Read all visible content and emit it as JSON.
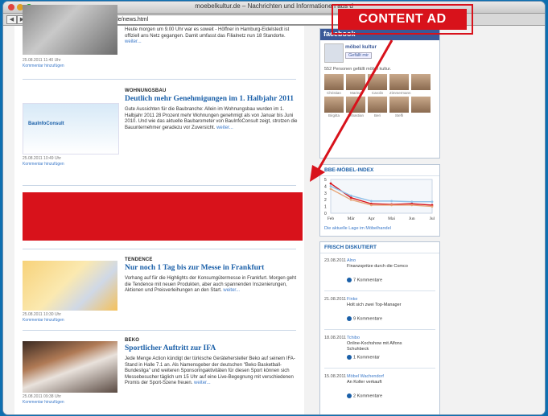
{
  "window": {
    "title": "moebelkultur.de – Nachrichten und Informationen aus d",
    "url": "http://www.moebelkultur.de/news.html"
  },
  "annotation": {
    "label": "CONTENT AD"
  },
  "articles": [
    {
      "category": "",
      "headline": "",
      "text": "Heute morgen um 9.00 Uhr war es soweit - Höffner in Hamburg-Eidelstedt ist offiziell ans Netz gegangen. Damit umfasst das Filialnetz nun 18 Standorte.",
      "more": "weiter...",
      "date": "25.08.2011 11:40 Uhr",
      "comment": "Kommentar hinzufügen"
    },
    {
      "category": "WOHNUNGSBAU",
      "headline": "Deutlich mehr Genehmigungen im 1. Halbjahr 2011",
      "thumb_label": "BauInfoConsult",
      "text": "Gute Aussichten für die Baubranche: Allein im Wohnungsbau wurden im 1. Halbjahr 2011 28 Prozent mehr Wohnungen genehmigt als von Januar bis Juni 2010. Und wie das aktuelle Baubarometer von BauInfoConsult zeigt, strotzen die Bauunternehmer geradezu vor Zuversicht.",
      "more": "weiter...",
      "date": "25.08.2011 10:49 Uhr",
      "comment": "Kommentar hinzufügen"
    },
    {
      "category": "TENDENCE",
      "headline": "Nur noch 1 Tag bis zur Messe in Frankfurt",
      "text": "Vorhang auf für die Highlights der Konsumgütermesse in Frankfurt. Morgen geht die Tendence mit neuen Produkten, aber auch spannenden Inszenierungen, Aktionen und Preisverleihungen an den Start.",
      "more": "weiter...",
      "date": "25.08.2011 10:30 Uhr",
      "comment": "Kommentar hinzufügen"
    },
    {
      "category": "BEKO",
      "headline": "Sportlicher Auftritt zur IFA",
      "text": "Jede Menge Action kündigt der türkische Gerätehersteller Beko auf seinem IFA-Stand in Halle 7.1 an. Als Namensgeber der deutschen \"Beko Basketball-Bundesliga\" und weiteren Sponsoringaktivitäten für diesen Sport können sich Messebesucher täglich um 15 Uhr auf eine Live-Begegnung mit verschiedenen Promis der Sport-Szene freuen.",
      "more": "weiter...",
      "date": "25.08.2011 09:38 Uhr",
      "comment": "Kommentar hinzufügen"
    }
  ],
  "facebook": {
    "header": "facebook",
    "page_name": "möbel kultur",
    "like": "Gefällt mir",
    "fans_line": "552 Personen gefällt möbel kultur.",
    "fans_row1": [
      "Christian",
      "Marina",
      "Carolin",
      "Zimmermann",
      ""
    ],
    "fans_row2": [
      "Birgitta",
      "Sebastian",
      "Beri",
      "Steffi",
      ""
    ]
  },
  "index": {
    "title": "BBE-MÖBEL-INDEX",
    "link": "Die aktuelle Lage im Möbelhandel",
    "chart_data": {
      "type": "line",
      "categories": [
        "Feb",
        "Mär",
        "Apr",
        "Mai",
        "Jun",
        "Jul"
      ],
      "ylim": [
        0,
        5
      ],
      "yticks": [
        "5",
        "4",
        "3",
        "2",
        "1",
        "0"
      ],
      "series": [
        {
          "color": "#d8121b",
          "values": [
            4.4,
            2.3,
            1.4,
            1.3,
            1.4,
            1.2
          ]
        },
        {
          "color": "#8fc0e8",
          "values": [
            4.0,
            2.6,
            1.8,
            1.8,
            1.7,
            1.7
          ]
        },
        {
          "color": "#e7a77a",
          "values": [
            3.6,
            2.0,
            1.2,
            1.2,
            1.2,
            1.0
          ]
        }
      ]
    }
  },
  "discussed": {
    "title": "FRISCH DISKUTIERT",
    "items": [
      {
        "date": "23.08.2011",
        "title": "Alno",
        "subtitle": "Finanzspritze durch die Comco",
        "comments": "7 Kommentare"
      },
      {
        "date": "21.08.2011",
        "title": "Finke",
        "subtitle": "Holt sich zwei Top-Manager",
        "comments": "9 Kommentare"
      },
      {
        "date": "18.08.2011",
        "title": "Tchibo",
        "subtitle": "Online-Kochshow mit Alfons Schuhbeck",
        "comments": "1 Kommentar"
      },
      {
        "date": "15.08.2011",
        "title": "Möbel Wachendorf",
        "subtitle": "An Koller verkauft",
        "comments": "2 Kommentare"
      }
    ]
  }
}
